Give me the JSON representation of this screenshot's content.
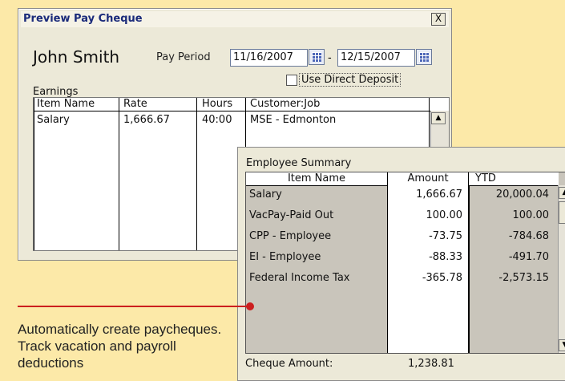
{
  "window": {
    "title": "Preview Pay Cheque",
    "close_label": "X"
  },
  "employee": {
    "name": "John Smith"
  },
  "pay_period": {
    "label": "Pay Period",
    "start": "11/16/2007",
    "separator": "-",
    "end": "12/15/2007"
  },
  "direct_deposit": {
    "label": "Use Direct Deposit",
    "checked": false
  },
  "earnings": {
    "label": "Earnings",
    "columns": [
      "Item Name",
      "Rate",
      "Hours",
      "Customer:Job"
    ],
    "rows": [
      [
        "Salary",
        "1,666.67",
        "40:00",
        "MSE - Edmonton"
      ]
    ]
  },
  "summary": {
    "title": "Employee Summary",
    "columns": [
      "Item Name",
      "Amount",
      "YTD"
    ],
    "rows": [
      [
        "Salary",
        "1,666.67",
        "20,000.04"
      ],
      [
        "VacPay-Paid Out",
        "100.00",
        "100.00"
      ],
      [
        "CPP - Employee",
        "-73.75",
        "-784.68"
      ],
      [
        "EI - Employee",
        "-88.33",
        "-491.70"
      ],
      [
        "Federal Income Tax",
        "-365.78",
        "-2,573.15"
      ]
    ],
    "cheque_label": "Cheque Amount:",
    "cheque_amount": "1,238.81"
  },
  "caption": "Automatically create paycheques. Track vacation and payroll deductions",
  "colors": {
    "background": "#fce9a8",
    "accent": "#cc1f1f"
  }
}
